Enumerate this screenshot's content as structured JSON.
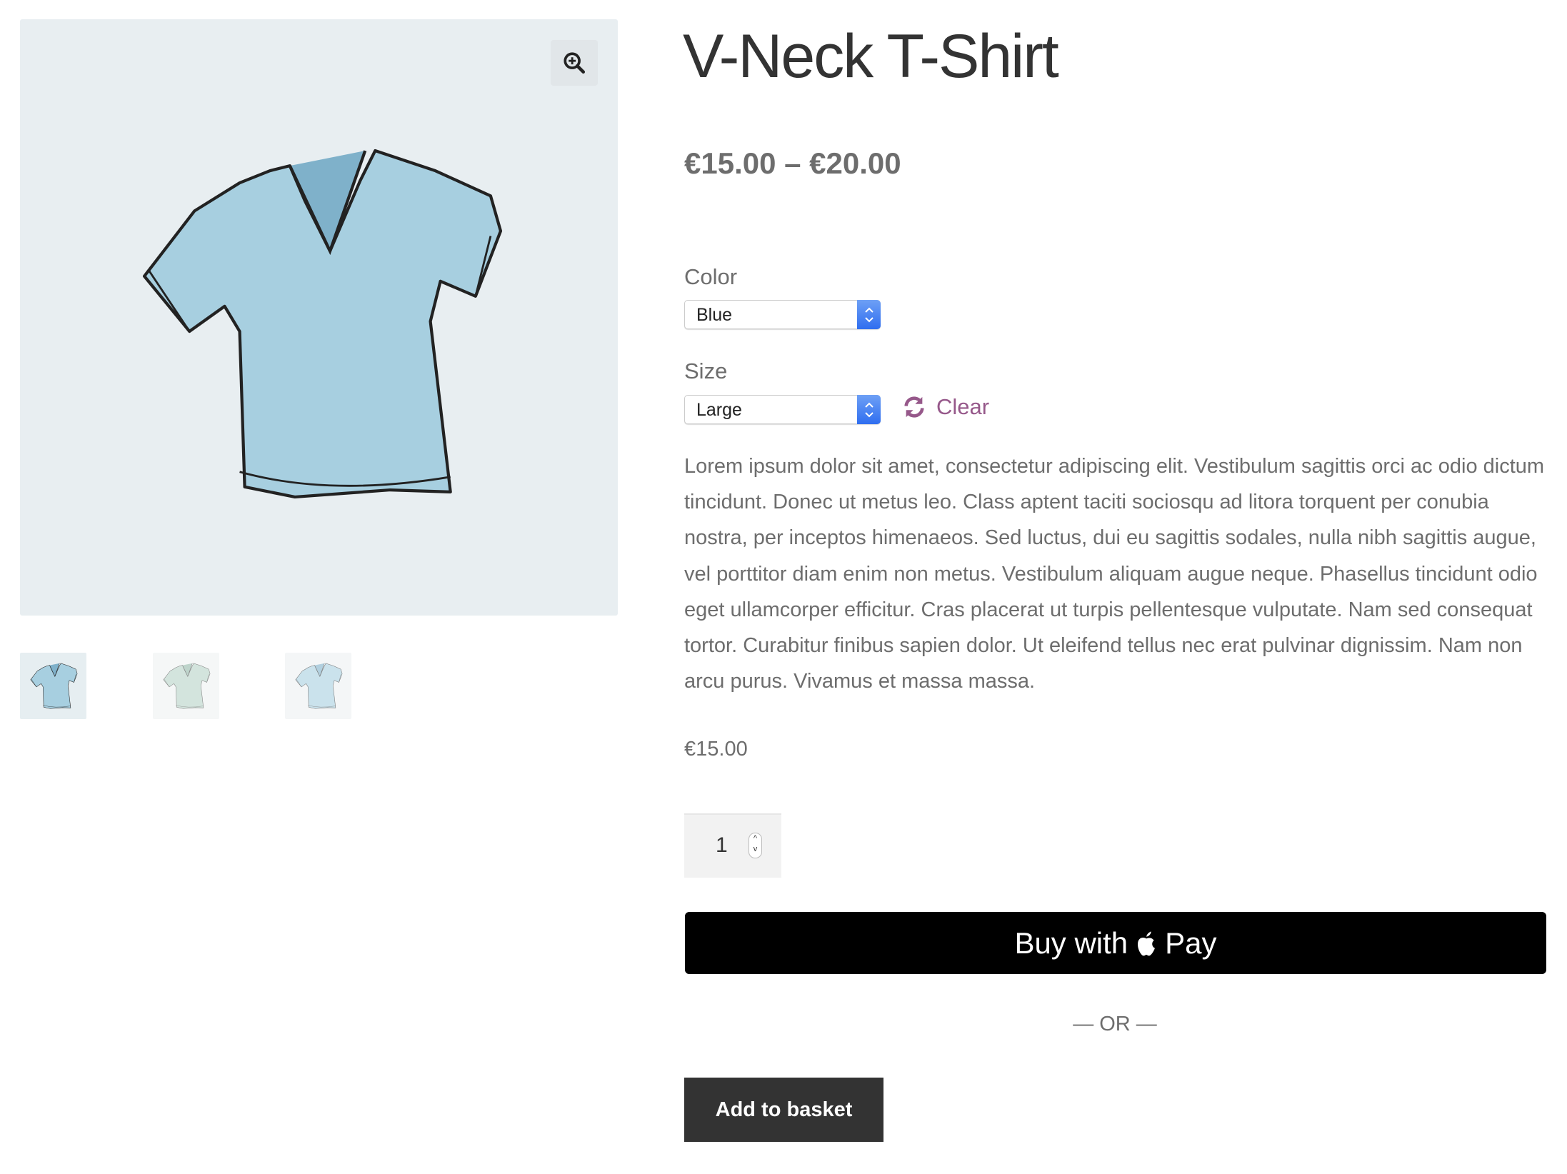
{
  "gallery": {
    "zoom_icon": "magnifier-plus-icon",
    "thumbnails": [
      "blue",
      "green",
      "light-blue"
    ]
  },
  "product": {
    "title": "V-Neck T-Shirt",
    "price_range": "€15.00 – €20.00",
    "color_label": "Color",
    "color_value": "Blue",
    "size_label": "Size",
    "size_value": "Large",
    "clear_label": "Clear",
    "description": "Lorem ipsum dolor sit amet, consectetur adipiscing elit. Vestibulum sagittis orci ac odio dictum tincidunt. Donec ut metus leo. Class aptent taciti sociosqu ad litora torquent per conubia nostra, per inceptos himenaeos. Sed luctus, dui eu sagittis sodales, nulla nibh sagittis augue, vel porttitor diam enim non metus. Vestibulum aliquam augue neque. Phasellus tincidunt odio eget ullamcorper efficitur. Cras placerat ut turpis pellentesque vulputate. Nam sed consequat tortor. Curabitur finibus sapien dolor. Ut eleifend tellus nec erat pulvinar dignissim. Nam non arcu purus. Vivamus et massa massa.",
    "variation_price": "€15.00",
    "quantity": "1"
  },
  "actions": {
    "apple_pay_prefix": "Buy with",
    "apple_pay_suffix": "Pay",
    "or_label": "— OR —",
    "add_to_basket": "Add to basket"
  },
  "colors": {
    "accent": "#96588a",
    "button_dark": "#333333",
    "image_bg": "#e8eef1",
    "select_blue": "#2f6ef0"
  }
}
